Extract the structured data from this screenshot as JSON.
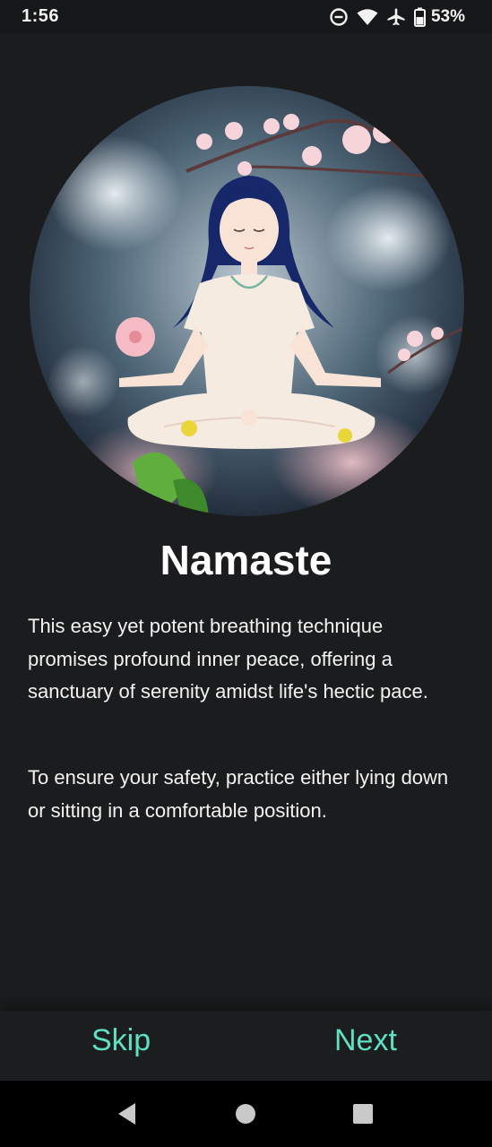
{
  "status_bar": {
    "time": "1:56",
    "battery_percent": "53%",
    "icons": [
      "do-not-disturb-icon",
      "wifi-icon",
      "airplane-icon",
      "battery-icon"
    ]
  },
  "hero": {
    "image_alt": "meditation-illustration"
  },
  "content": {
    "title": "Namaste",
    "paragraph_1": "This easy yet potent breathing technique promises profound inner peace, offering a sanctuary of serenity amidst life's hectic pace.",
    "paragraph_2": "To ensure your safety, practice either lying down or sitting in a comfortable position."
  },
  "actions": {
    "skip_label": "Skip",
    "next_label": "Next"
  },
  "system_nav": {
    "icons": [
      "back-icon",
      "home-icon",
      "recents-icon"
    ]
  },
  "colors": {
    "background": "#1b1c1d",
    "accent": "#5fe0c3",
    "text": "#ffffff"
  }
}
